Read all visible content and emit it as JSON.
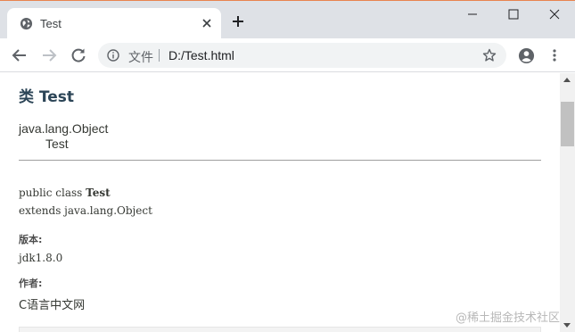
{
  "browser": {
    "tab_title": "Test",
    "file_label": "文件",
    "url": "D:/Test.html",
    "icons": [
      "globe-icon",
      "close-icon",
      "plus-icon",
      "minimize-icon",
      "maximize-icon",
      "window-close-icon",
      "back-arrow-icon",
      "forward-arrow-icon",
      "reload-icon",
      "info-icon",
      "star-icon",
      "profile-icon",
      "menu-icon"
    ]
  },
  "page": {
    "title": "类 Test",
    "hierarchy_root": "java.lang.Object",
    "hierarchy_child": "Test",
    "signature_prefix": "public class ",
    "signature_name": "Test",
    "signature_extends": "extends java.lang.Object",
    "version_label": "版本:",
    "version_value": "jdk1.8.0",
    "author_label": "作者:",
    "author_value": "C语言中文网"
  },
  "watermark": "@稀土掘金技术社区",
  "colors": {
    "title": "#2c4557",
    "text": "#353833",
    "tabstrip": "#dee1e6",
    "omnibox": "#f1f3f4"
  }
}
